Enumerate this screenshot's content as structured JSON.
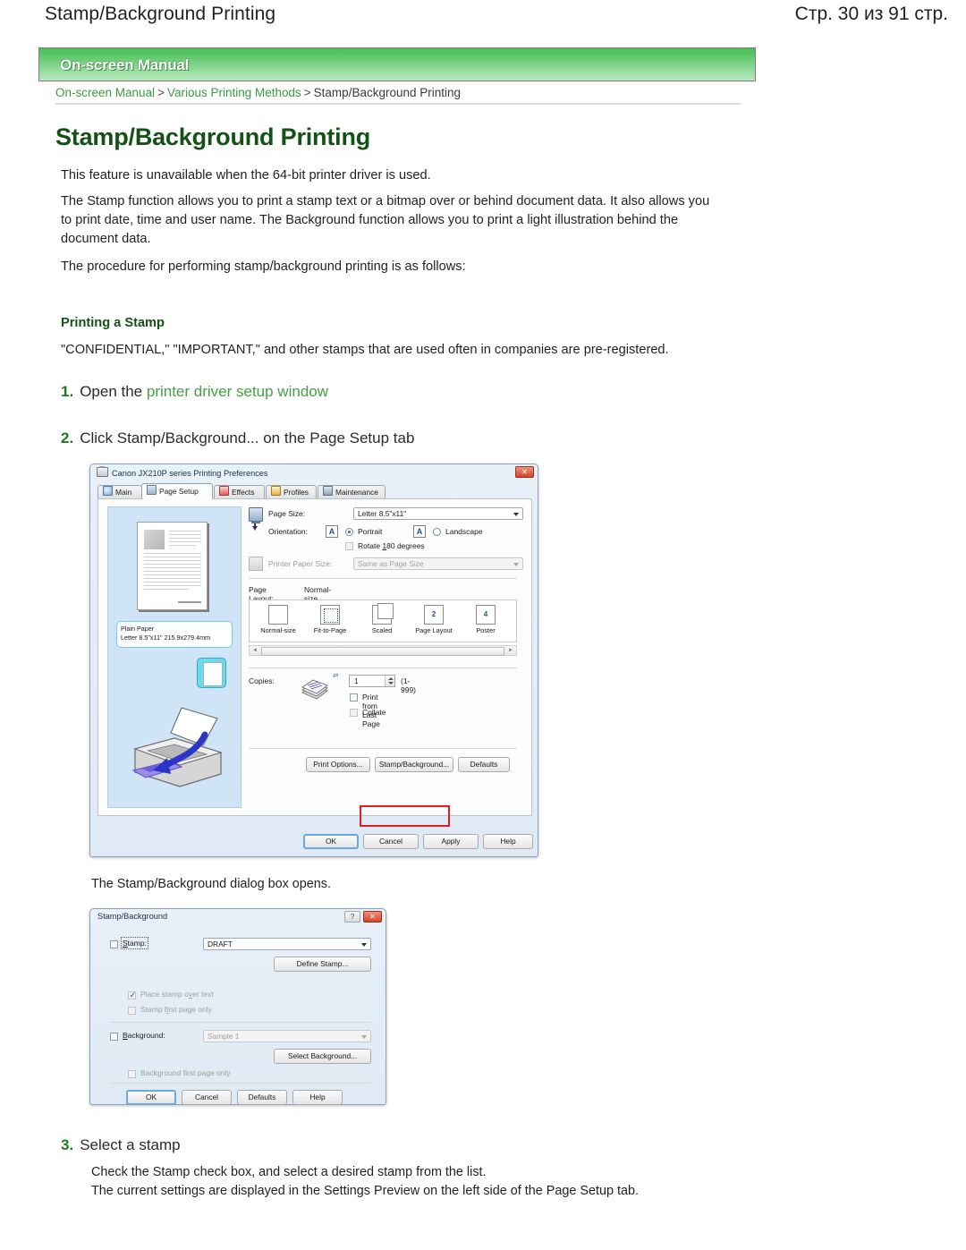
{
  "header": {
    "doc_title": "Stamp/Background Printing",
    "page_number": "Стр. 30 из 91 стр."
  },
  "banner": {
    "label": "On-screen Manual"
  },
  "breadcrumb": {
    "root": "On-screen Manual",
    "sep": ">",
    "section": "Various Printing Methods",
    "current": "Stamp/Background Printing"
  },
  "article": {
    "title": "Stamp/Background Printing",
    "para_1": "This feature is unavailable when the 64-bit printer driver is used.",
    "para_2": "The Stamp function allows you to print a stamp text or a bitmap over or behind document data. It also allows you to print date, time and user name. The Background function allows you to print a light illustration behind the document data.",
    "para_3": "The procedure for performing stamp/background printing is as follows:",
    "subhead": "Printing a Stamp",
    "para_4": "\"CONFIDENTIAL,\" \"IMPORTANT,\" and other stamps that are used often in companies are pre-registered."
  },
  "steps": [
    {
      "num": "1.",
      "text_before": "Open the ",
      "link": "printer driver setup window",
      "text_after": ""
    },
    {
      "num": "2.",
      "text_before": "Click Stamp/Background... on the Page Setup tab",
      "link": "",
      "text_after": ""
    },
    {
      "num": "3.",
      "text_before": "Select a stamp",
      "link": "",
      "text_after": ""
    }
  ],
  "captions": {
    "after_prefs": "The Stamp/Background dialog box opens.",
    "step3_line1": "Check the Stamp check box, and select a desired stamp from the list.",
    "step3_line2": "The current settings are displayed in the Settings Preview on the left side of the Page Setup tab."
  },
  "prefs_dialog": {
    "title": "Canon JX210P series Printing Preferences",
    "close_label": "✕",
    "tabs": [
      {
        "label": "Main",
        "selected": false
      },
      {
        "label": "Page Setup",
        "selected": true
      },
      {
        "label": "Effects",
        "selected": false
      },
      {
        "label": "Profiles",
        "selected": false
      },
      {
        "label": "Maintenance",
        "selected": false
      }
    ],
    "preview": {
      "paper_type": "Plain Paper",
      "paper_size": "Letter 8.5\"x11\" 215.9x279.4mm"
    },
    "page_size": {
      "label": "Page Size:",
      "value": "Letter 8.5\"x11\""
    },
    "orientation": {
      "label": "Orientation:",
      "portrait": "Portrait",
      "landscape": "Landscape",
      "portrait_selected": true,
      "rotate_label": "Rotate 180 degrees",
      "rotate_checked": false,
      "glyph": "A"
    },
    "printer_paper_size": {
      "label": "Printer Paper Size:",
      "value": "Same as Page Size",
      "disabled": true
    },
    "page_layout": {
      "label": "Page Layout:",
      "value": "Normal-size",
      "items": [
        {
          "label": "Normal-size",
          "badge": ""
        },
        {
          "label": "Fit-to-Page",
          "badge": ""
        },
        {
          "label": "Scaled",
          "badge": ""
        },
        {
          "label": "Page Layout",
          "badge": "2"
        },
        {
          "label": "Poster",
          "badge": "4"
        }
      ]
    },
    "copies": {
      "label": "Copies:",
      "value": "1",
      "range": "(1-999)",
      "print_last_page": "Print from Last Page",
      "print_last_page_checked": false,
      "collate": "Collate",
      "collate_checked": false,
      "collate_disabled": true
    },
    "footer_buttons": [
      {
        "label": "Print Options...",
        "highlighted": false
      },
      {
        "label": "Stamp/Background...",
        "highlighted": true
      },
      {
        "label": "Defaults",
        "highlighted": false
      }
    ],
    "action_buttons": [
      {
        "label": "OK",
        "default": true
      },
      {
        "label": "Cancel",
        "default": false
      },
      {
        "label": "Apply",
        "default": false
      },
      {
        "label": "Help",
        "default": false
      }
    ]
  },
  "stamp_dialog": {
    "title": "Stamp/Background",
    "help_label": "?",
    "close_label": "✕",
    "stamp": {
      "checkbox_label": "Stamp:",
      "checked": false,
      "value": "DRAFT",
      "define_button": "Define Stamp..."
    },
    "options": [
      {
        "label": "Place stamp over text",
        "checked": true,
        "disabled": true
      },
      {
        "label": "Stamp first page only",
        "checked": false,
        "disabled": true
      }
    ],
    "background": {
      "checkbox_label": "Background:",
      "checked": false,
      "value": "Sample 1",
      "select_button": "Select Background...",
      "first_page_only": "Background first page only",
      "first_page_only_checked": false
    },
    "action_buttons": [
      {
        "label": "OK",
        "default": true
      },
      {
        "label": "Cancel",
        "default": false
      },
      {
        "label": "Defaults",
        "default": false
      },
      {
        "label": "Help",
        "default": false
      }
    ]
  },
  "colors": {
    "brand_green": "#3c9a41",
    "heading_green": "#135214",
    "banner_green": "#4cbf5a",
    "highlight_red": "#e51c23",
    "preview_blue": "#cfe4f7"
  }
}
